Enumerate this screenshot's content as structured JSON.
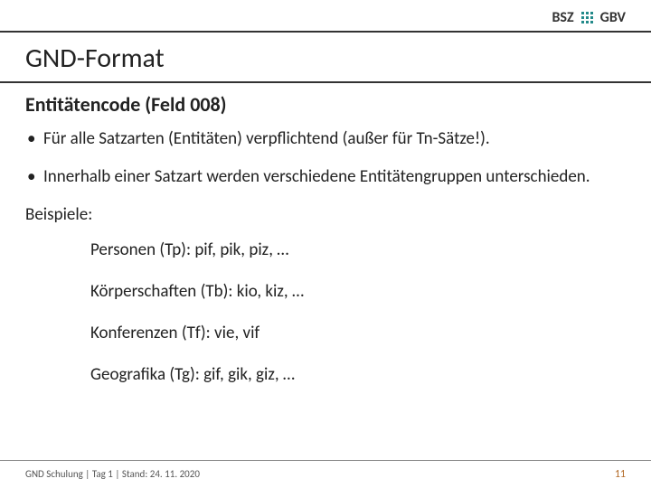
{
  "header": {
    "brand_left": "BSZ",
    "brand_right": "GBV"
  },
  "title": "GND-Format",
  "subhead": "Entitätencode (Feld 008)",
  "bullets": [
    "Für alle Satzarten (Entitäten) verpflichtend (außer für Tn-Sätze!).",
    "Innerhalb einer Satzart werden verschiedene Entitätengruppen unterschieden."
  ],
  "examples_label": "Beispiele:",
  "examples": [
    "Personen (Tp): pif, pik, piz, …",
    "Körperschaften (Tb): kio, kiz, …",
    "Konferenzen (Tf): vie, vif",
    "Geografika (Tg): gif, gik, giz, …"
  ],
  "footer": {
    "left": "GND Schulung | Tag 1 | Stand: 24. 11. 2020",
    "page": "11"
  }
}
